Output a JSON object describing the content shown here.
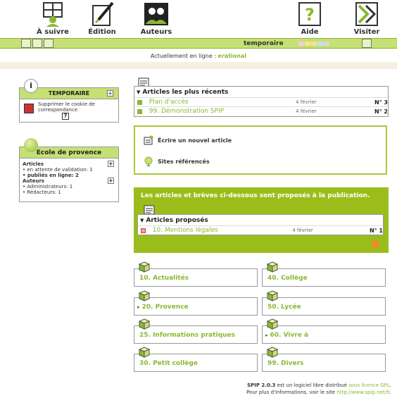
{
  "nav": {
    "items": [
      {
        "label": "À suivre",
        "icon": "follow-icon"
      },
      {
        "label": "Édition",
        "icon": "edit-icon"
      },
      {
        "label": "Auteurs",
        "icon": "authors-icon"
      },
      {
        "label": "Aide",
        "icon": "help-icon"
      },
      {
        "label": "Visiter",
        "icon": "visit-icon"
      }
    ]
  },
  "greenbar": {
    "title": "temporaire"
  },
  "online": {
    "prefix": "Actuellement en ligne :",
    "user": "erational"
  },
  "temporaire_box": {
    "title": "TEMPORAIRE",
    "toggle": "+",
    "cookie_text": "Supprimer le cookie de correspondance",
    "help": "?"
  },
  "ecole_box": {
    "title": "Ecole de provence",
    "articles_label": "Articles",
    "toggle": "+",
    "pending": "en attente de validation: 1",
    "published": "publiés en ligne: 2",
    "authors_label": "Auteurs",
    "admins": "Administrateurs: 1",
    "redactors": "Rédacteurs: 1"
  },
  "recent": {
    "title": "Articles les plus récents",
    "rows": [
      {
        "title": "Plan d'accès",
        "date": "4 février",
        "num": "N° 3"
      },
      {
        "title": "99. Démonstration SPIP",
        "date": "4 février",
        "num": "N° 2"
      }
    ]
  },
  "actions": {
    "write": "Écrire un nouvel article",
    "sites": "Sites référencés"
  },
  "proposed": {
    "notice": "Les articles et brèves ci-dessous sont proposés à la publication.",
    "title": "Articles proposés",
    "rows": [
      {
        "title": "10. Mentions légales",
        "date": "4 février",
        "num": "N° 1"
      }
    ]
  },
  "rubriques": [
    {
      "label": "10. Actualités",
      "arrow": ""
    },
    {
      "label": "40. Collège",
      "arrow": ""
    },
    {
      "label": "20. Provence",
      "arrow": "▸"
    },
    {
      "label": "50. Lycée",
      "arrow": ""
    },
    {
      "label": "25. Informations pratiques",
      "arrow": ""
    },
    {
      "label": "60. Vivre à",
      "arrow": "▸"
    },
    {
      "label": "30. Petit collège",
      "arrow": ""
    },
    {
      "label": "99. Divers",
      "arrow": ""
    }
  ],
  "footer": {
    "line1_a": "SPIP 2.0.3",
    "line1_b": " est un logiciel libre distribué ",
    "line1_link": "sous licence GPL",
    "line1_end": ".",
    "line2_a": "Pour plus d'informations, voir le site ",
    "line2_link": "http://www.spip.net/fr",
    "line2_end": "."
  },
  "colors": {
    "accent_green": "#8ab833",
    "bar_green": "#c5e074",
    "panel_green": "#9bbd1b"
  }
}
